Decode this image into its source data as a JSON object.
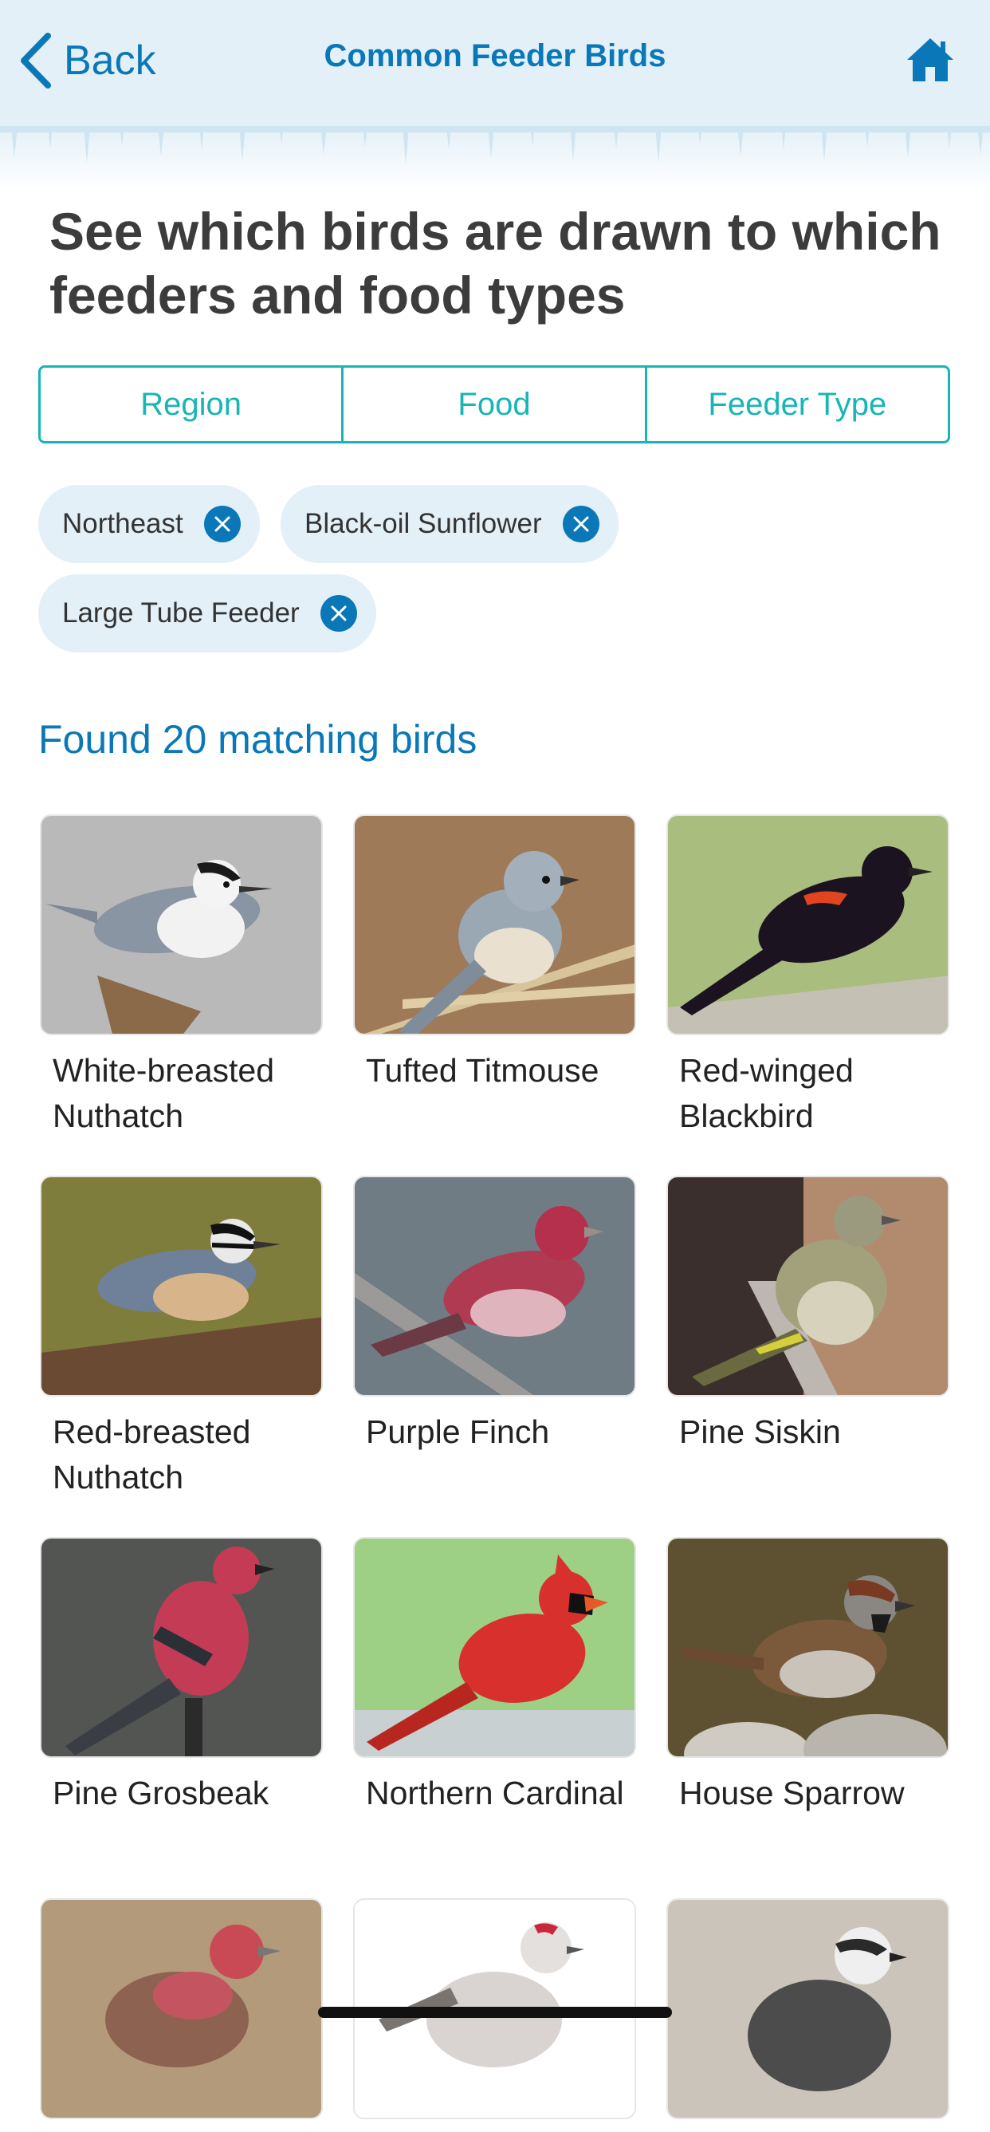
{
  "nav": {
    "back_label": "Back",
    "title": "Common Feeder Birds",
    "accent_color": "#0a78b8"
  },
  "heading": "See which birds are drawn to which feeders and food types",
  "filter_tabs": [
    "Region",
    "Food",
    "Feeder Type"
  ],
  "active_filters": [
    "Northeast",
    "Black-oil Sunflower",
    "Large Tube Feeder"
  ],
  "results_text": "Found 20 matching birds",
  "birds": [
    {
      "name": "White-breasted Nuthatch"
    },
    {
      "name": "Tufted Titmouse"
    },
    {
      "name": "Red-winged Blackbird"
    },
    {
      "name": "Red-breasted Nuthatch"
    },
    {
      "name": "Purple Finch"
    },
    {
      "name": "Pine Siskin"
    },
    {
      "name": "Pine Grosbeak"
    },
    {
      "name": "Northern Cardinal"
    },
    {
      "name": "House Sparrow"
    },
    {
      "name": ""
    },
    {
      "name": ""
    },
    {
      "name": ""
    }
  ],
  "colors": {
    "nav_background": "#e3f0f8",
    "filter_accent": "#19b5b5",
    "chip_background": "#e3f0f8"
  }
}
